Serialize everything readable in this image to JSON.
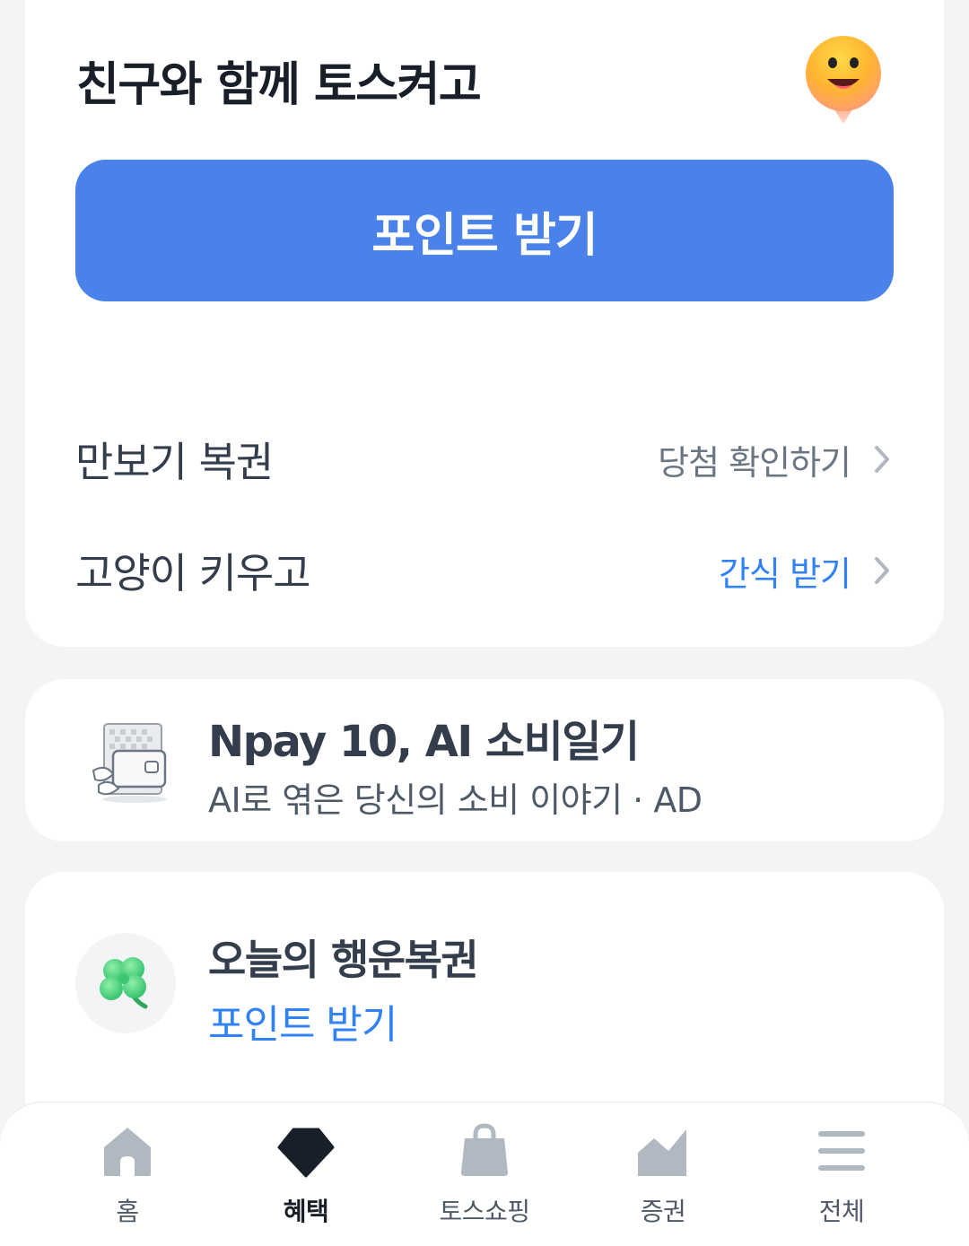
{
  "top_card": {
    "title": "친구와 함께 토스켜고",
    "emoji_icon": "smiling-face-pin-icon",
    "primary_button": "포인트 받기",
    "rows": [
      {
        "label": "만보기 복권",
        "action": "당첨 확인하기",
        "action_color": "#6b7684"
      },
      {
        "label": "고양이 키우고",
        "action": "간식 받기",
        "action_color": "#3182f6"
      }
    ]
  },
  "ad_card": {
    "title": "Npay 10, AI 소비일기",
    "subtitle": "AI로 엮은 당신의 소비 이야기 · AD",
    "thumbnail_icon": "wallet-illustration-icon"
  },
  "lucky_card": {
    "title": "오늘의 행운복권",
    "action": "포인트 받기",
    "icon": "four-leaf-clover-icon"
  },
  "bottom_nav": {
    "items": [
      {
        "label": "홈",
        "icon": "home-icon",
        "active": false
      },
      {
        "label": "혜택",
        "icon": "gem-icon",
        "active": true
      },
      {
        "label": "토스쇼핑",
        "icon": "shopping-bag-icon",
        "active": false
      },
      {
        "label": "증권",
        "icon": "stock-chart-icon",
        "active": false
      },
      {
        "label": "전체",
        "icon": "menu-icon",
        "active": false
      }
    ]
  },
  "colors": {
    "accent": "#4a82ea",
    "link_blue": "#3182f6",
    "background": "#f2f4f6",
    "nav_icon_inactive": "#b0b8c1",
    "nav_icon_active": "#191f28"
  }
}
